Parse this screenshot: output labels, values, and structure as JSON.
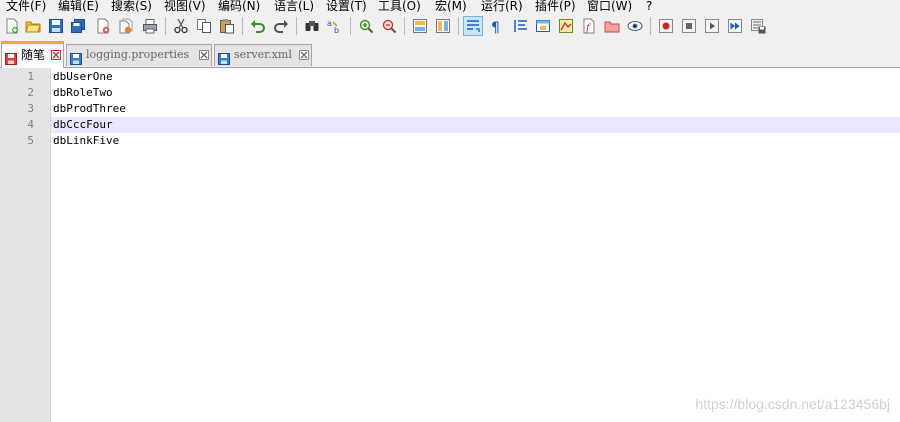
{
  "menu": {
    "items": [
      "文件(F)",
      "编辑(E)",
      "搜索(S)",
      "视图(V)",
      "编码(N)",
      "语言(L)",
      "设置(T)",
      "工具(O)",
      "宏(M)",
      "运行(R)",
      "插件(P)",
      "窗口(W)",
      "?"
    ]
  },
  "toolbar": {
    "icons": [
      "new-file-icon",
      "open-file-icon",
      "save-icon",
      "save-all-icon",
      "close-icon",
      "close-all-icon",
      "print-icon",
      "cut-icon",
      "copy-icon",
      "paste-icon",
      "undo-icon",
      "redo-icon",
      "find-icon",
      "replace-icon",
      "zoom-in-icon",
      "zoom-out-icon",
      "sync-vertical-icon",
      "sync-horizontal-icon",
      "word-wrap-icon",
      "show-all-characters-icon",
      "indent-guide-icon",
      "user-language-icon",
      "document-map-icon",
      "function-list-icon",
      "folder-workspace-icon",
      "monitoring-icon",
      "record-macro-icon",
      "stop-recording-icon",
      "playback-icon",
      "run-macro-multiple-icon",
      "save-macro-icon"
    ]
  },
  "tabs": [
    {
      "label": "随笔",
      "active": true,
      "color": "#e04040"
    },
    {
      "label": "logging.properties",
      "active": false,
      "color": "#3a7fd0"
    },
    {
      "label": "server.xml",
      "active": false,
      "color": "#3a7fd0"
    }
  ],
  "editor": {
    "current_line": 4,
    "lines": [
      {
        "number": "1",
        "text": "dbUserOne"
      },
      {
        "number": "2",
        "text": "dbRoleTwo"
      },
      {
        "number": "3",
        "text": "dbProdThree"
      },
      {
        "number": "4",
        "text": "dbCccFour"
      },
      {
        "number": "5",
        "text": "dbLinkFive"
      }
    ]
  },
  "watermark": "https://blog.csdn.net/a123456bj"
}
